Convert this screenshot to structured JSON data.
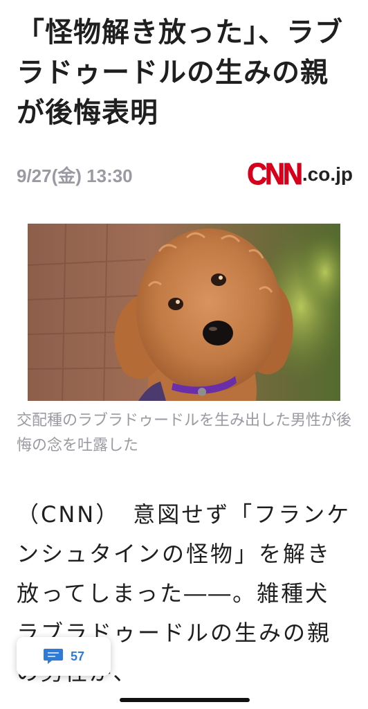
{
  "article": {
    "headline": "「怪物解き放った」、ラブラドゥードルの生みの親が後悔表明",
    "date": "9/27(金) 13:30",
    "source_logo": {
      "main": "CNN",
      "suffix": ".co.jp"
    },
    "image": {
      "description_icon": "dog-photo"
    },
    "caption": "交配種のラブラドゥードルを生み出した男性が後悔の念を吐露した",
    "body": "（CNN）　意図せず「フランケンシュタインの怪物」を解き放ってしまった――。雑種犬ラブラドゥードルの生みの親の男性が、"
  },
  "comments": {
    "count": "57",
    "icon": "comment-bubble-icon"
  },
  "colors": {
    "accent": "#2d7bd6",
    "brand": "#d6001c",
    "muted": "#9a9aa2"
  }
}
